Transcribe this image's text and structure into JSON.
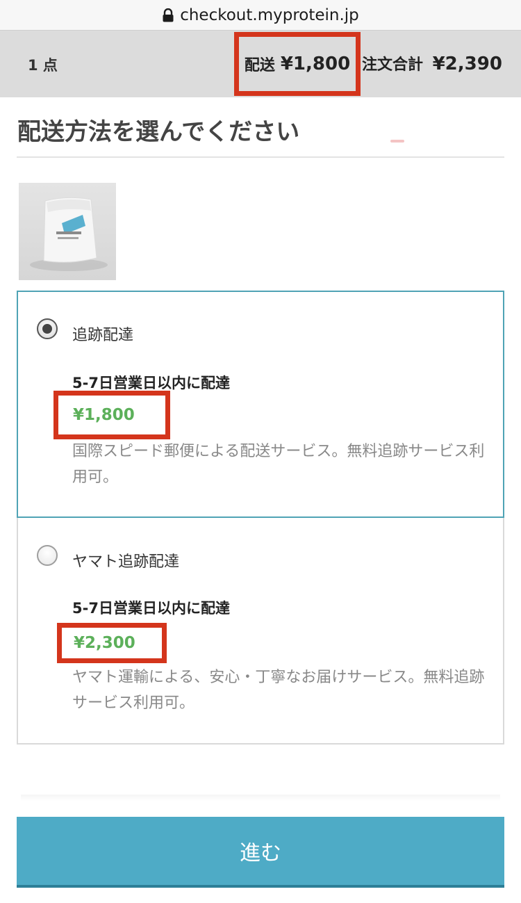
{
  "url_bar": {
    "host": "checkout.myprotein.jp"
  },
  "summary": {
    "item_count": "1 点",
    "shipping_label": "配送",
    "shipping_value": "¥1,800",
    "total_label": "注文合計",
    "total_value": "¥2,390"
  },
  "page": {
    "heading": "配送方法を選んでください"
  },
  "options": [
    {
      "name": "追跡配達",
      "selected": true,
      "eta": "5-7日営業日以内に配達",
      "price": "¥1,800",
      "description": "国際スピード郵便による配送サービス。無料追跡サービス利用可。"
    },
    {
      "name": "ヤマト追跡配達",
      "selected": false,
      "eta": "5-7日営業日以内に配達",
      "price": "¥2,300",
      "description": "ヤマト運輸による、安心・丁寧なお届けサービス。無料追跡サービス利用可。"
    }
  ],
  "actions": {
    "proceed_label": "進む"
  },
  "colors": {
    "accent": "#4eabc6",
    "price": "#5cb05a",
    "highlight": "#d4351c",
    "selected_border": "#4fa3b5"
  }
}
